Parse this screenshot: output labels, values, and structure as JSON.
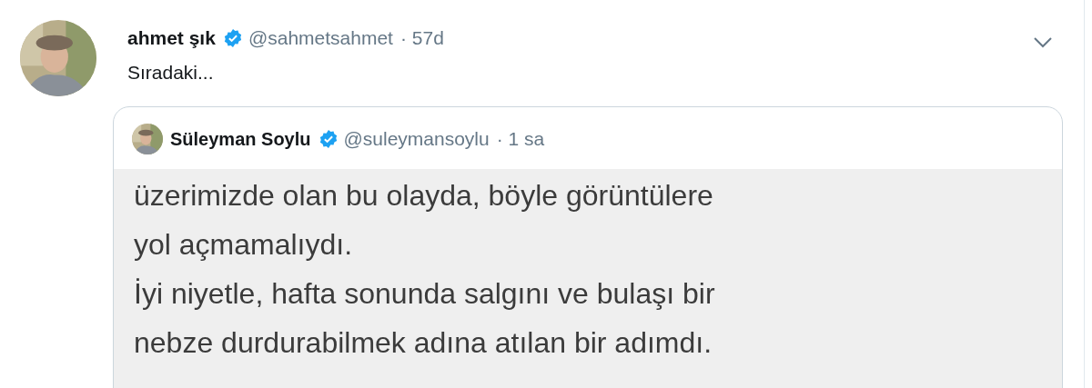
{
  "tweet": {
    "author": {
      "name": "ahmet şık",
      "verified": true,
      "handle": "@sahmetsahmet",
      "time": "· 57d"
    },
    "text": "Sıradaki...",
    "quote": {
      "author": {
        "name": "Süleyman Soylu",
        "verified": true,
        "handle": "@suleymansoylu",
        "time": "· 1 sa"
      },
      "image_lines": [
        "üzerimizde olan bu olayda, böyle görüntülere",
        "yol açmamalıydı.",
        "İyi niyetle, hafta sonunda salgını ve bulaşı bir",
        "nebze durdurabilmek adına atılan bir adımdı."
      ]
    }
  }
}
